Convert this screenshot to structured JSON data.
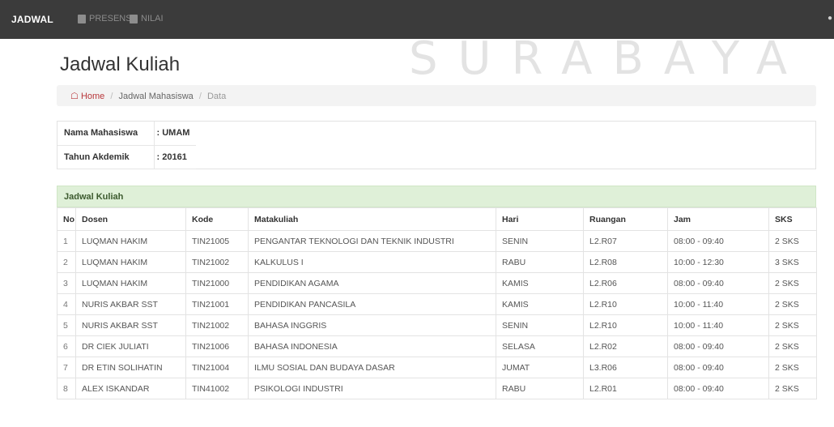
{
  "nav": {
    "brand": "JADWAL",
    "items": [
      {
        "label": "PRESENSI",
        "icon": "clipboard-icon"
      },
      {
        "label": "NILAI",
        "icon": "chart-icon"
      }
    ]
  },
  "watermark": "SURABAYA",
  "page": {
    "title": "Jadwal Kuliah"
  },
  "breadcrumb": {
    "home": "Home",
    "middle": "Jadwal Mahasiswa",
    "current": "Data"
  },
  "student": {
    "name_label": "Nama Mahasiswa",
    "name_value": ": UMAM",
    "year_label": "Tahun Akdemik",
    "year_value": ": 20161"
  },
  "schedule": {
    "panel_title": "Jadwal Kuliah",
    "columns": [
      "No",
      "Dosen",
      "Kode",
      "Matakuliah",
      "Hari",
      "Ruangan",
      "Jam",
      "SKS"
    ],
    "rows": [
      [
        "1",
        "LUQMAN HAKIM",
        "TIN21005",
        "PENGANTAR TEKNOLOGI DAN TEKNIK INDUSTRI",
        "SENIN",
        "L2.R07",
        "08:00 - 09:40",
        "2 SKS"
      ],
      [
        "2",
        "LUQMAN HAKIM",
        "TIN21002",
        "KALKULUS I",
        "RABU",
        "L2.R08",
        "10:00 - 12:30",
        "3 SKS"
      ],
      [
        "3",
        "LUQMAN HAKIM",
        "TIN21000",
        "PENDIDIKAN AGAMA",
        "KAMIS",
        "L2.R06",
        "08:00 - 09:40",
        "2 SKS"
      ],
      [
        "4",
        "NURIS AKBAR SST",
        "TIN21001",
        "PENDIDIKAN PANCASILA",
        "KAMIS",
        "L2.R10",
        "10:00 - 11:40",
        "2 SKS"
      ],
      [
        "5",
        "NURIS AKBAR SST",
        "TIN21002",
        "BAHASA INGGRIS",
        "SENIN",
        "L2.R10",
        "10:00 - 11:40",
        "2 SKS"
      ],
      [
        "6",
        "DR CIEK JULIATI",
        "TIN21006",
        "BAHASA INDONESIA",
        "SELASA",
        "L2.R02",
        "08:00 - 09:40",
        "2 SKS"
      ],
      [
        "7",
        "DR ETIN SOLIHATIN",
        "TIN21004",
        "ILMU SOSIAL DAN BUDAYA DASAR",
        "JUMAT",
        "L3.R06",
        "08:00 - 09:40",
        "2 SKS"
      ],
      [
        "8",
        "ALEX ISKANDAR",
        "TIN41002",
        "PSIKOLOGI INDUSTRI",
        "RABU",
        "L2.R01",
        "08:00 - 09:40",
        "2 SKS"
      ]
    ]
  }
}
